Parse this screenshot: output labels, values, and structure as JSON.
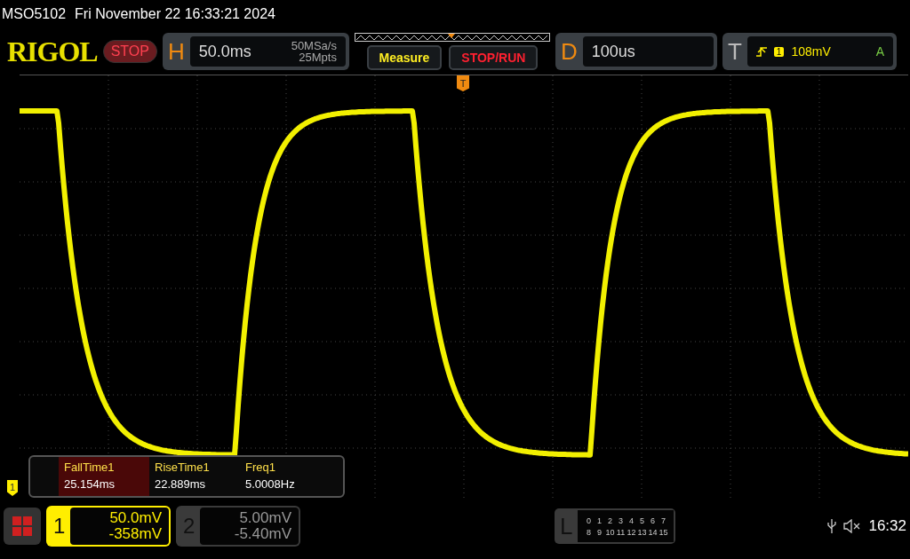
{
  "title": {
    "model": "MSO5102",
    "datetime": "Fri November 22 16:33:21 2024"
  },
  "toolbar": {
    "logo": "RIGOL",
    "run_state": "STOP",
    "horizontal": {
      "label": "H",
      "timebase": "50.0ms",
      "sample_rate": "50MSa/s",
      "memory": "25Mpts"
    },
    "buttons": [
      {
        "label": "Measure",
        "kind": "measure"
      },
      {
        "label": "STOP/RUN",
        "kind": "run"
      }
    ],
    "delay": {
      "label": "D",
      "value": "100us"
    },
    "trigger": {
      "label": "T",
      "source": "1",
      "level": "108mV",
      "mode": "A"
    }
  },
  "trigger_marker": "T",
  "channel_marker": "1",
  "measurements": [
    {
      "name": "FallTime1",
      "value": "25.154ms",
      "selected": true
    },
    {
      "name": "RiseTime1",
      "value": "22.889ms",
      "selected": false
    },
    {
      "name": "Freq1",
      "value": "5.0008Hz",
      "selected": false
    }
  ],
  "channels": [
    {
      "number": "1",
      "scale": "50.0mV",
      "offset": "-358mV",
      "active": true
    },
    {
      "number": "2",
      "scale": "5.00mV",
      "offset": "-5.40mV",
      "active": false
    }
  ],
  "logic": {
    "label": "L",
    "rows": [
      [
        "0",
        "1",
        "2",
        "3",
        "4",
        "5",
        "6",
        "7"
      ],
      [
        "8",
        "9",
        "10",
        "11",
        "12",
        "13",
        "14",
        "15"
      ]
    ]
  },
  "status": {
    "time": "16:32"
  }
}
